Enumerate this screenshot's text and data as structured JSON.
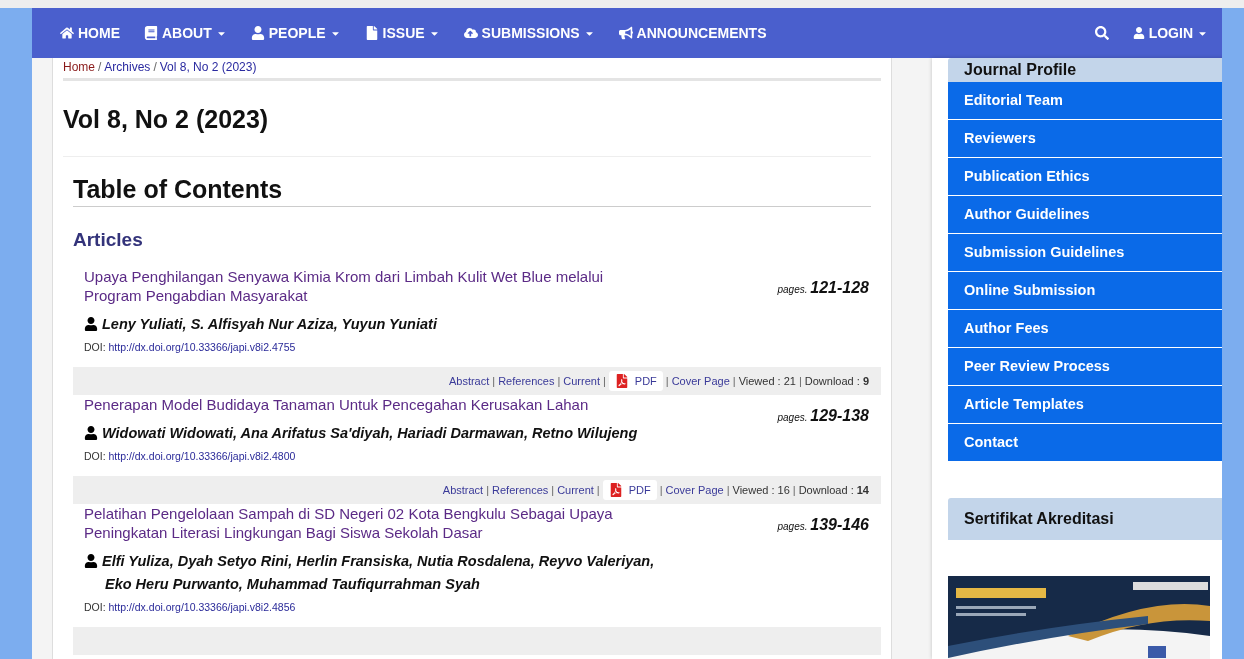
{
  "navbar": {
    "items": [
      {
        "label": "HOME",
        "dropdown": false
      },
      {
        "label": "ABOUT",
        "dropdown": true
      },
      {
        "label": "PEOPLE",
        "dropdown": true
      },
      {
        "label": "ISSUE",
        "dropdown": true
      },
      {
        "label": "SUBMISSIONS",
        "dropdown": true
      },
      {
        "label": "ANNOUNCEMENTS",
        "dropdown": false
      }
    ],
    "login": {
      "label": "LOGIN",
      "dropdown": true
    }
  },
  "breadcrumb": [
    {
      "kind": "link",
      "text": "Home"
    },
    {
      "kind": "sep",
      "text": "/"
    },
    {
      "kind": "link",
      "text": "Archives"
    },
    {
      "kind": "sep",
      "text": "/"
    },
    {
      "kind": "link",
      "text": "Vol 8, No 2 (2023)"
    }
  ],
  "issue_title": "Vol 8, No 2 (2023)",
  "toc_heading": "Table of Contents",
  "section_heading": "Articles",
  "articles": [
    {
      "title": "Upaya Penghilangan Senyawa Kimia Krom dari Limbah Kulit Wet Blue melalui Program Pengabdian Masyarakat",
      "authors": [
        "Leny Yuliati, S. Alfisyah Nur Aziza, Yuyun Yuniati"
      ],
      "doi_label": "DOI:",
      "doi": "http://dx.doi.org/10.33366/japi.v8i2.4755",
      "pages_label": "pages.",
      "pages": "121-128",
      "actions": [
        {
          "kind": "link",
          "text": "Abstract"
        },
        {
          "kind": "sep",
          "text": "|"
        },
        {
          "kind": "link",
          "text": "References"
        },
        {
          "kind": "sep",
          "text": "|"
        },
        {
          "kind": "link",
          "text": "Current"
        },
        {
          "kind": "sep",
          "text": "|"
        },
        {
          "kind": "pdf",
          "text": "PDF"
        },
        {
          "kind": "sep",
          "text": "|"
        },
        {
          "kind": "link",
          "text": "Cover Page"
        },
        {
          "kind": "sep",
          "text": "|"
        },
        {
          "kind": "stat",
          "text": "Viewed : 21"
        },
        {
          "kind": "sep",
          "text": "|"
        },
        {
          "kind": "stat",
          "text": "Download : **9**"
        }
      ]
    },
    {
      "title": "Penerapan Model Budidaya Tanaman Untuk Pencegahan Kerusakan Lahan",
      "authors": [
        "Widowati Widowati, Ana Arifatus Sa'diyah, Hariadi Darmawan, Retno Wilujeng"
      ],
      "doi_label": "DOI:",
      "doi": "http://dx.doi.org/10.33366/japi.v8i2.4800",
      "pages_label": "pages.",
      "pages": "129-138",
      "actions": [
        {
          "kind": "link",
          "text": "Abstract"
        },
        {
          "kind": "sep",
          "text": "|"
        },
        {
          "kind": "link",
          "text": "References"
        },
        {
          "kind": "sep",
          "text": "|"
        },
        {
          "kind": "link",
          "text": "Current"
        },
        {
          "kind": "sep",
          "text": "|"
        },
        {
          "kind": "pdf",
          "text": "PDF"
        },
        {
          "kind": "sep",
          "text": "|"
        },
        {
          "kind": "link",
          "text": "Cover Page"
        },
        {
          "kind": "sep",
          "text": "|"
        },
        {
          "kind": "stat",
          "text": "Viewed : 16"
        },
        {
          "kind": "sep",
          "text": "|"
        },
        {
          "kind": "stat",
          "text": "Download : **14**"
        }
      ]
    },
    {
      "title": "Pelatihan Pengelolaan Sampah di SD Negeri 02 Kota Bengkulu Sebagai Upaya Peningkatan Literasi Lingkungan Bagi Siswa Sekolah Dasar",
      "authors": [
        "Elfi Yuliza, Dyah Setyo Rini, Herlin Fransiska, Nutia Rosdalena, Reyvo Valeriyan,",
        "Eko Heru Purwanto, Muhammad Taufiqurrahman Syah"
      ],
      "doi_label": "DOI:",
      "doi": "http://dx.doi.org/10.33366/japi.v8i2.4856",
      "pages_label": "pages.",
      "pages": "139-146"
    }
  ],
  "sidebar": {
    "profile_heading": "Journal Profile",
    "menu": [
      "Editorial Team",
      "Reviewers",
      "Publication Ethics",
      "Author Guidelines",
      "Submission Guidelines",
      "Online Submission",
      "Author Fees",
      "Peer Review Process",
      "Article Templates",
      "Contact"
    ],
    "certificate_heading": "Sertifikat Akreditasi"
  }
}
